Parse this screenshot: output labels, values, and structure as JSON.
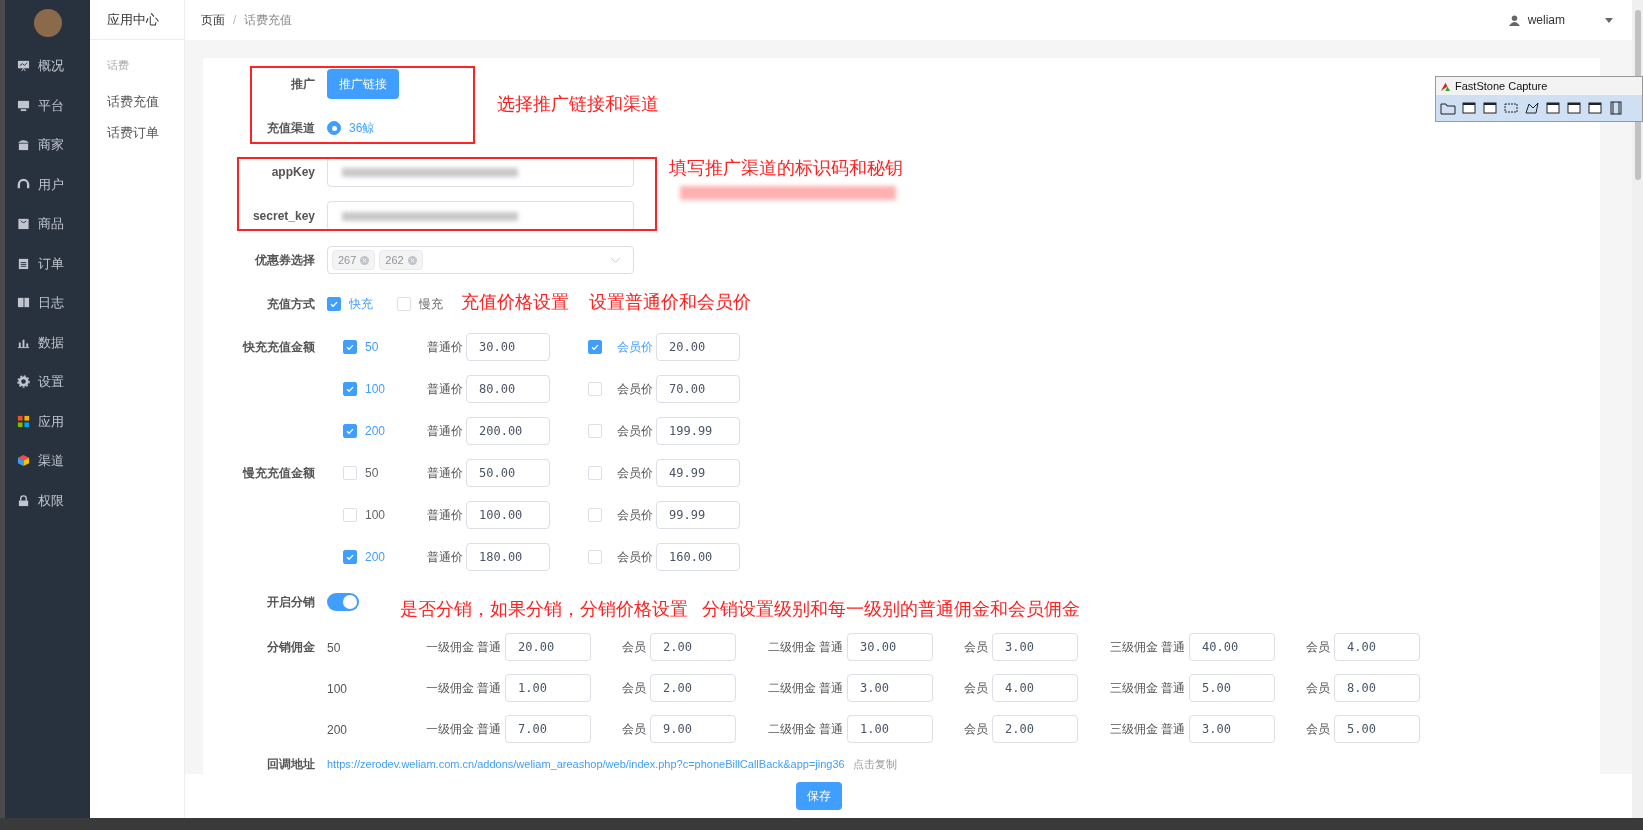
{
  "sidebar": {
    "items": [
      {
        "label": "概况"
      },
      {
        "label": "平台"
      },
      {
        "label": "商家"
      },
      {
        "label": "用户"
      },
      {
        "label": "商品"
      },
      {
        "label": "订单"
      },
      {
        "label": "日志"
      },
      {
        "label": "数据"
      },
      {
        "label": "设置"
      },
      {
        "label": "应用"
      },
      {
        "label": "渠道"
      },
      {
        "label": "权限"
      }
    ]
  },
  "subnav": {
    "title": "应用中心",
    "group": "话费",
    "items": [
      {
        "label": "话费充值"
      },
      {
        "label": "话费订单"
      }
    ]
  },
  "header": {
    "breadcrumb": [
      "页面",
      "话费充值"
    ],
    "separator": "/",
    "user": "weliam"
  },
  "form": {
    "promo": {
      "label": "推广",
      "button": "推广链接"
    },
    "channel": {
      "label": "充值渠道",
      "options": [
        {
          "label": "36鲸",
          "selected": true
        }
      ]
    },
    "app_key": {
      "label": "appKey"
    },
    "secret_key": {
      "label": "secret_key"
    },
    "coupon": {
      "label": "优惠券选择",
      "tags": [
        "267",
        "262"
      ]
    },
    "charge_mode": {
      "label": "充值方式",
      "options": [
        {
          "label": "快充",
          "checked": true
        },
        {
          "label": "慢充",
          "checked": false
        }
      ]
    },
    "price_groups": [
      {
        "label": "快充充值金额",
        "rows": [
          {
            "amount": "50",
            "checked": true,
            "normal_label": "普通价",
            "normal_price": "30.00",
            "member_checked": true,
            "member_label": "会员价",
            "member_price": "20.00"
          },
          {
            "amount": "100",
            "checked": true,
            "normal_label": "普通价",
            "normal_price": "80.00",
            "member_checked": false,
            "member_label": "会员价",
            "member_price": "70.00"
          },
          {
            "amount": "200",
            "checked": true,
            "normal_label": "普通价",
            "normal_price": "200.00",
            "member_checked": false,
            "member_label": "会员价",
            "member_price": "199.99"
          }
        ]
      },
      {
        "label": "慢充充值金额",
        "rows": [
          {
            "amount": "50",
            "checked": false,
            "normal_label": "普通价",
            "normal_price": "50.00",
            "member_checked": false,
            "member_label": "会员价",
            "member_price": "49.99"
          },
          {
            "amount": "100",
            "checked": false,
            "normal_label": "普通价",
            "normal_price": "100.00",
            "member_checked": false,
            "member_label": "会员价",
            "member_price": "99.99"
          },
          {
            "amount": "200",
            "checked": true,
            "normal_label": "普通价",
            "normal_price": "180.00",
            "member_checked": false,
            "member_label": "会员价",
            "member_price": "160.00"
          }
        ]
      }
    ],
    "distribution": {
      "label": "开启分销",
      "on": true
    },
    "commission": {
      "label": "分销佣金",
      "rows": [
        {
          "amount": "50",
          "levels": [
            {
              "label": "一级佣金 普通",
              "normal": "20.00",
              "member_label": "会员",
              "member": "2.00"
            },
            {
              "label": "二级佣金 普通",
              "normal": "30.00",
              "member_label": "会员",
              "member": "3.00"
            },
            {
              "label": "三级佣金 普通",
              "normal": "40.00",
              "member_label": "会员",
              "member": "4.00"
            }
          ]
        },
        {
          "amount": "100",
          "levels": [
            {
              "label": "一级佣金 普通",
              "normal": "1.00",
              "member_label": "会员",
              "member": "2.00"
            },
            {
              "label": "二级佣金 普通",
              "normal": "3.00",
              "member_label": "会员",
              "member": "4.00"
            },
            {
              "label": "三级佣金 普通",
              "normal": "5.00",
              "member_label": "会员",
              "member": "8.00"
            }
          ]
        },
        {
          "amount": "200",
          "levels": [
            {
              "label": "一级佣金 普通",
              "normal": "7.00",
              "member_label": "会员",
              "member": "9.00"
            },
            {
              "label": "二级佣金 普通",
              "normal": "1.00",
              "member_label": "会员",
              "member": "2.00"
            },
            {
              "label": "三级佣金 普通",
              "normal": "3.00",
              "member_label": "会员",
              "member": "5.00"
            }
          ]
        }
      ]
    },
    "callback": {
      "label": "回调地址",
      "url": "https://zerodev.weliam.com.cn/addons/weliam_areashop/web/index.php?c=phoneBillCallBack&app=jing36",
      "copy": "点击复制"
    },
    "save": "保存"
  },
  "annotations": [
    "选择推广链接和渠道",
    "填写推广渠道的标识码和秘钥",
    "充值价格设置",
    "设置普通价和会员价",
    "是否分销，如果分销，分销价格设置",
    "分销设置级别和每一级别的普通佣金和会员佣金"
  ],
  "capture_toolbar": {
    "title": "FastStone Capture"
  }
}
